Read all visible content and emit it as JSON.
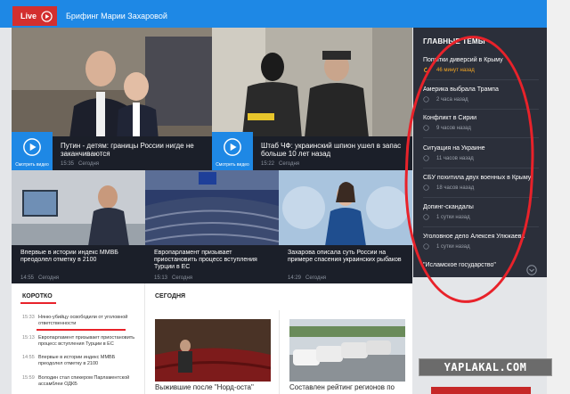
{
  "topbar": {
    "live_label": "Live",
    "briefing": "Брифинг Марии Захаровой"
  },
  "featured": [
    {
      "title": "Путин - детям: границы России нигде не заканчиваются",
      "time": "15:35",
      "day": "Сегодня",
      "video_label": "Смотреть видео"
    },
    {
      "title": "Штаб ЧФ: украинский шпион ушел в запас больше 10 лет назад",
      "time": "15:22",
      "day": "Сегодня",
      "video_label": "Смотреть видео"
    }
  ],
  "small_cards": [
    {
      "title": "Впервые в истории индекс ММВБ преодолел отметку в 2100",
      "time": "14:55",
      "day": "Сегодня"
    },
    {
      "title": "Европарламент призывает приостановить процесс вступления Турции в ЕС",
      "time": "15:13",
      "day": "Сегодня"
    },
    {
      "title": "Захарова описала суть России на примере спасения украинских рыбаков",
      "time": "14:29",
      "day": "Сегодня"
    }
  ],
  "main_topics": {
    "title": "ГЛАВНЫЕ ТЕМЫ",
    "items": [
      {
        "title": "Попытки диверсий в Крыму",
        "meta": "46 минут назад"
      },
      {
        "title": "Америка выбрала Трампа",
        "meta": "2 часа назад"
      },
      {
        "title": "Конфликт в Сирии",
        "meta": "9 часов назад"
      },
      {
        "title": "Ситуация на Украине",
        "meta": "11 часов назад"
      },
      {
        "title": "СБУ похитила двух военных в Крыму",
        "meta": "18 часов назад"
      },
      {
        "title": "Допинг-скандалы",
        "meta": "1 сутки назад"
      },
      {
        "title": "Уголовное дело Алексея Улюкаева",
        "meta": "1 сутки назад"
      }
    ],
    "more": "\"Исламское государство\""
  },
  "korotko": {
    "title": "КОРОТКО",
    "items": [
      {
        "time": "15:33",
        "text": "Няню-убийцу освободили от уголовной ответственности"
      },
      {
        "time": "15:13",
        "text": "Европарламент призывает приостановить процесс вступления Турции в ЕС"
      },
      {
        "time": "14:55",
        "text": "Впервые в истории индекс ММВБ преодолел отметку в 2100"
      },
      {
        "time": "15:59",
        "text": "Володин стал спикером Парламентской ассамблеи ОДКБ"
      }
    ]
  },
  "segodnya": {
    "title": "СЕГОДНЯ",
    "cards": [
      {
        "title": "Выжившие после \"Норд-оста\""
      },
      {
        "title": "Составлен рейтинг регионов по"
      }
    ]
  },
  "watermark": "YAPLAKAL.COM"
}
